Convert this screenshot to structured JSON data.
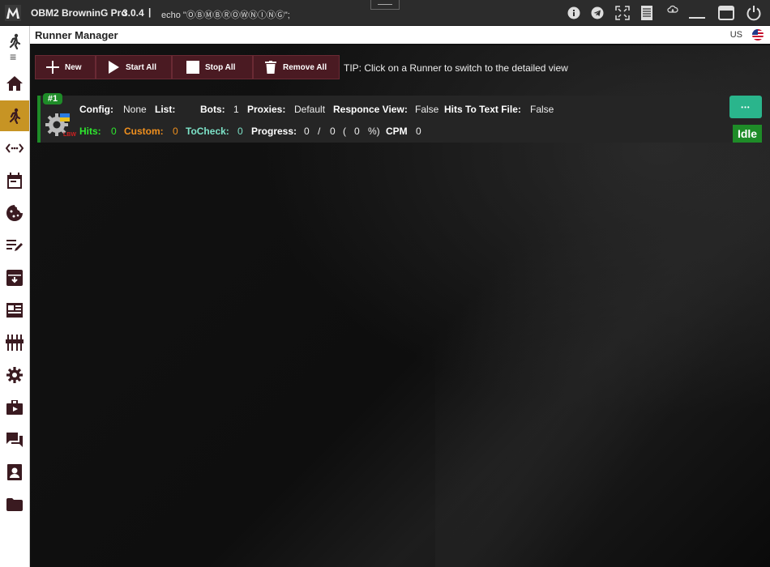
{
  "titlebar": {
    "title": "OBM2 BrowninG Pro",
    "version": "3.0.4",
    "separator": "|",
    "echo": "echo \"ⓄⒷⓂⒷⓇⓄⓌⓃⒾⓃⒼ\";",
    "icons": [
      "info-icon",
      "telegram-icon",
      "fullscreen-icon",
      "log-icon",
      "cloud-icon",
      "minimize-icon",
      "maximize-icon",
      "power-icon"
    ]
  },
  "header": {
    "title": "Runner Manager",
    "language": "US"
  },
  "sidebar": {
    "items": [
      "runner-icon",
      "home-icon",
      "proxy-icon",
      "calendar-icon",
      "cookie-icon",
      "editor-icon",
      "archive-icon",
      "wordlist-icon",
      "plugins-icon",
      "settings-icon",
      "jobs-icon",
      "chat-icon",
      "account-icon",
      "folder-icon"
    ],
    "active": "runner-icon"
  },
  "toolbar": {
    "new_label": "New",
    "start_all_label": "Start All",
    "stop_all_label": "Stop All",
    "remove_all_label": "Remove All",
    "tip": "TIP: Click on a Runner to switch to the detailed view"
  },
  "runner": {
    "badge": "#1",
    "config_label": "Config:",
    "config_value": "None",
    "list_label": "List:",
    "list_value": "",
    "bots_label": "Bots:",
    "bots_value": "1",
    "proxies_label": "Proxies:",
    "proxies_value": "Default",
    "response_view_label": "Responce View:",
    "response_view_value": "False",
    "hits_to_file_label": "Hits To Text File:",
    "hits_to_file_value": "False",
    "hits_label": "Hits:",
    "hits_value": "0",
    "custom_label": "Custom:",
    "custom_value": "0",
    "tocheck_label": "ToCheck:",
    "tocheck_value": "0",
    "progress_label": "Progress:",
    "progress_done": "0",
    "progress_sep": "/",
    "progress_total": "0",
    "progress_open": "(",
    "progress_pct": "0",
    "progress_close": "%)",
    "cpm_label": "CPM",
    "cpm_value": "0",
    "menu": "•••",
    "status": "Idle"
  },
  "colors": {
    "hits": "#2ee82e",
    "custom": "#f0901e",
    "tocheck": "#7de3c8",
    "accent_green": "#1e8c28",
    "menu_teal": "#2ab58c",
    "button_bg": "#4a1a22",
    "sidebar_active": "#c79424"
  }
}
